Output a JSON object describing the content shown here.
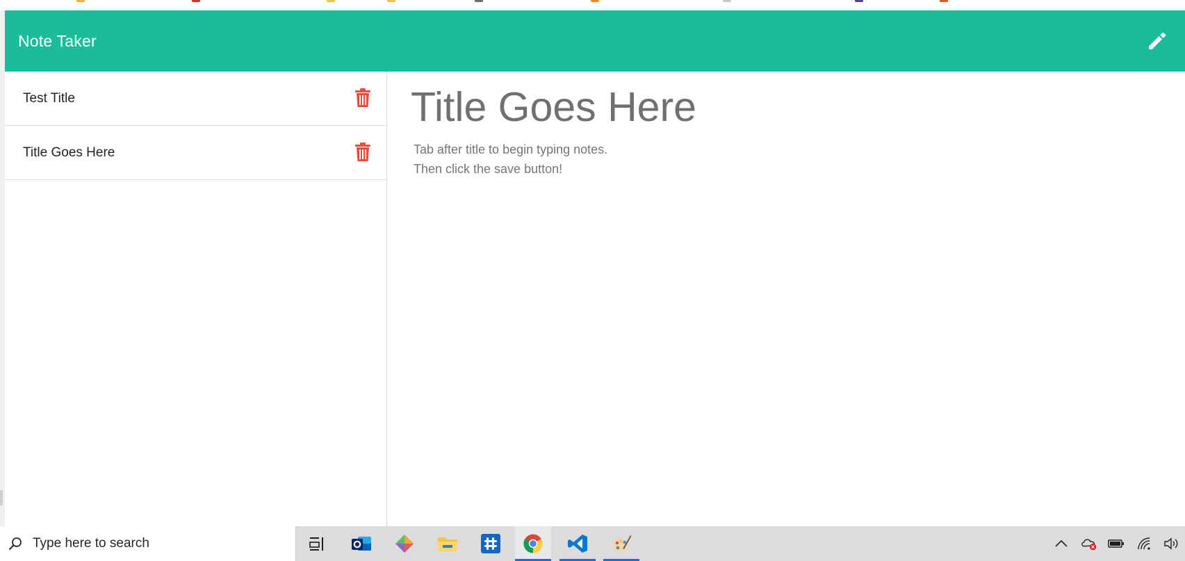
{
  "app": {
    "title": "Note Taker"
  },
  "colors": {
    "navbar": "#1abc9c",
    "delete_icon": "#e74c3c",
    "title_text": "#707070",
    "taskbar": "#dcdcdc"
  },
  "header": {
    "new_note_icon": "pencil-icon"
  },
  "notes": [
    {
      "title": "Test Title",
      "delete_icon": "trash-icon"
    },
    {
      "title": "Title Goes Here",
      "delete_icon": "trash-icon"
    }
  ],
  "editor": {
    "title_placeholder": "Title Goes Here",
    "text_placeholder_line1": "Tab  after title to begin typing notes.",
    "text_placeholder_line2": "Then click the save button!"
  },
  "taskbar": {
    "search_placeholder": "Type here to search",
    "apps": [
      {
        "name": "task-view"
      },
      {
        "name": "outlook"
      },
      {
        "name": "git-app"
      },
      {
        "name": "file-explorer"
      },
      {
        "name": "slack"
      },
      {
        "name": "chrome",
        "active": true
      },
      {
        "name": "vscode",
        "running": true
      },
      {
        "name": "paint",
        "running": true
      }
    ],
    "tray": [
      "chevron-up-icon",
      "onedrive-error-icon",
      "battery-icon",
      "wifi-icon",
      "speaker-icon"
    ]
  }
}
